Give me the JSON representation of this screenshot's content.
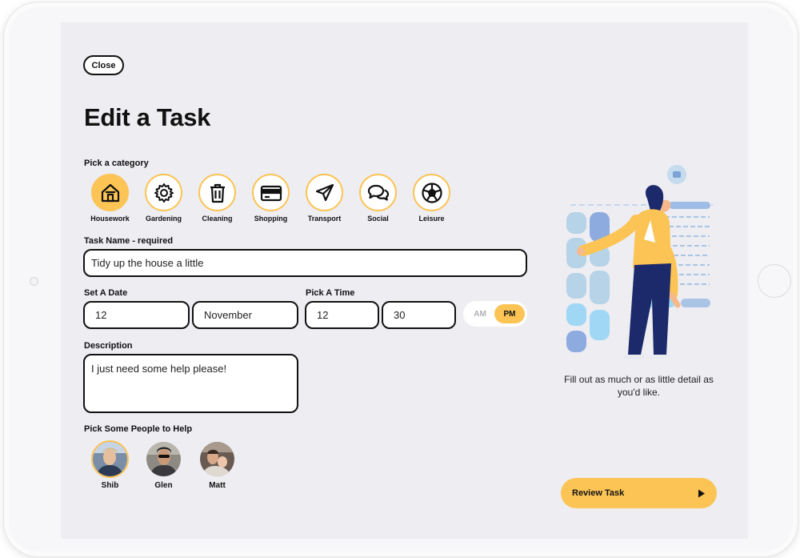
{
  "header": {
    "close_label": "Close",
    "title": "Edit a Task"
  },
  "category": {
    "label": "Pick a category",
    "items": [
      {
        "label": "Housework",
        "icon": "house-icon",
        "selected": true
      },
      {
        "label": "Gardening",
        "icon": "gear-icon",
        "selected": false
      },
      {
        "label": "Cleaning",
        "icon": "trash-icon",
        "selected": false
      },
      {
        "label": "Shopping",
        "icon": "credit-card-icon",
        "selected": false
      },
      {
        "label": "Transport",
        "icon": "paper-plane-icon",
        "selected": false
      },
      {
        "label": "Social",
        "icon": "chat-bubbles-icon",
        "selected": false
      },
      {
        "label": "Leisure",
        "icon": "soccer-ball-icon",
        "selected": false
      }
    ]
  },
  "task_name": {
    "label": "Task Name - required",
    "value": "Tidy up the house a little"
  },
  "date": {
    "label": "Set A Date",
    "day": "12",
    "month": "November"
  },
  "time": {
    "label": "Pick A Time",
    "hour": "12",
    "minute": "30",
    "am_label": "AM",
    "pm_label": "PM",
    "selected": "PM"
  },
  "description": {
    "label": "Description",
    "value": "I just need some help please!"
  },
  "people": {
    "label": "Pick Some People to Help",
    "items": [
      {
        "name": "Shib",
        "selected": true
      },
      {
        "name": "Glen",
        "selected": false
      },
      {
        "name": "Matt",
        "selected": false
      }
    ]
  },
  "side_panel": {
    "hint": "Fill out as much or as little detail as you'd like.",
    "review_label": "Review Task"
  },
  "colors": {
    "accent": "#fcc455",
    "background": "#ededf2",
    "text": "#111111"
  }
}
